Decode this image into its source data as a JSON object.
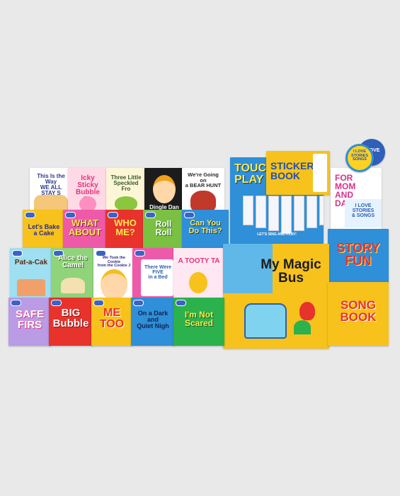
{
  "books": {
    "b01": "This Is the Way\nWE ALL STAY S",
    "b02": "Icky Sticky\nBubble Gu",
    "b03": "Three Little\nSpeckled Fro",
    "b04": "Dingle Dan",
    "b05": "We're Going on\na BEAR HUNT",
    "b06": "TOUCH\nPLAY",
    "b07": "STICKER\nBOOK",
    "b08": "LET'S SING AND PLAY!",
    "b09": "FOR\nMOM\nAND\nDA",
    "b10": "I LOVE\nSTORIES\n& SONGS",
    "b11": "Let's Bake\na Cake",
    "b12": "WHAT\nABOUT",
    "b13": "WHO\nME?",
    "b14": "Roll\nRoll",
    "b15": "Can You\nDo This?",
    "b16": "STORY\nFUN",
    "b17": "Pat-a-Cak",
    "b18": "Alice the\nCamel",
    "b19": "We Took the Cookie\nfrom the Cookie J",
    "b20": "There Were\nFIVE\nin a Bed",
    "b21": "A TOOTY TA",
    "b22": "My Magic\nBus",
    "b23": "SONG\nBOOK",
    "b24": "SAFE\nFIRS",
    "b25": "BIG\nBubble",
    "b26": "ME\nTOO",
    "b27": "On a Dark\nand\nQuiet Nigh",
    "b28": "I'm Not\nScared",
    "disc1": "I LOVE",
    "disc2": "I LOVE\nSTORIES\nSONGS"
  },
  "colors": {
    "background": "#e9e9ea",
    "yellow": "#f7c21b",
    "blue": "#2f8fd8",
    "pink": "#ee5aa8",
    "red": "#e8322c",
    "green": "#2bb24c"
  }
}
